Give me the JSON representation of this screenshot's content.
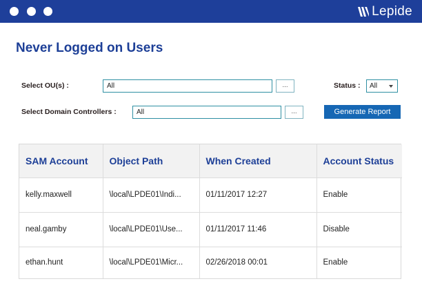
{
  "brand": {
    "name": "Lepide"
  },
  "page": {
    "title": "Never Logged on Users"
  },
  "filters": {
    "ou_label": "Select OU(s)   :",
    "ou_value": "All",
    "dc_label": "Select Domain Controllers   :",
    "dc_value": "All",
    "browse_label": "...",
    "status_label": "Status :",
    "status_value": "All",
    "generate_label": "Generate Report"
  },
  "table": {
    "columns": [
      "SAM Account",
      "Object Path",
      "When Created",
      "Account  Status"
    ],
    "rows": [
      [
        "kelly.maxwell",
        "\\local\\LPDE01\\Indi...",
        "01/11/2017 12:27",
        "Enable"
      ],
      [
        "neal.gamby",
        "\\local\\LPDE01\\Use...",
        "01/11/2017 11:46",
        "Disable"
      ],
      [
        "ethan.hunt",
        "\\local\\LPDE01\\Micr...",
        "02/26/2018 00:01",
        "Enable"
      ]
    ]
  },
  "colors": {
    "titlebar": "#1e3f9a",
    "accent": "#1d3f97",
    "button": "#1667b4"
  }
}
